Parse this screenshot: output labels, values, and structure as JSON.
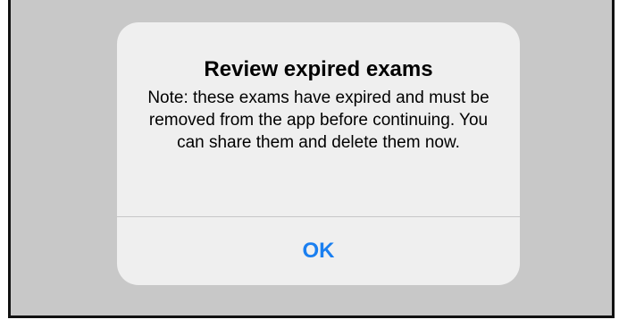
{
  "alert": {
    "title": "Review expired exams",
    "message": "Note: these exams have expired and must be removed from the app before continuing. You can share them and delete them now.",
    "ok_label": "OK"
  },
  "colors": {
    "overlay": "#c8c8c8",
    "alert_background": "#efefef",
    "button_text": "#1a7ff0",
    "divider": "#c6c6c8"
  }
}
